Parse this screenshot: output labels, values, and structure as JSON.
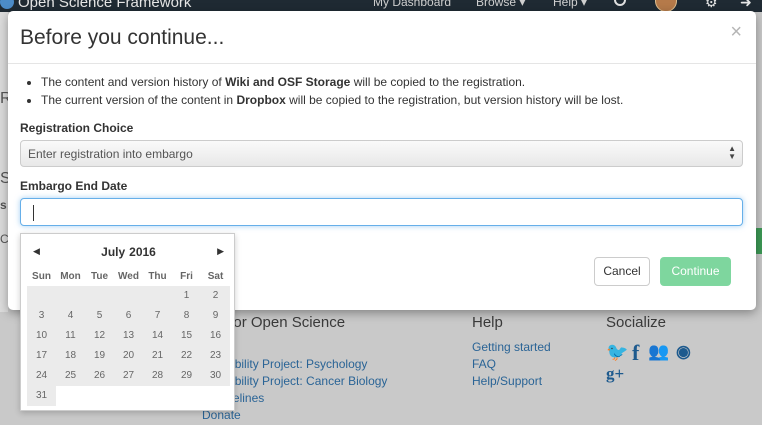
{
  "navbar": {
    "brand": "Open Science Framework",
    "links": [
      "My Dashboard",
      "Browse ▾",
      "Help ▾"
    ]
  },
  "background": {
    "left_chars": [
      "R",
      "S",
      "s",
      "C"
    ]
  },
  "footer": {
    "col1_title": "Center for Open Science",
    "col1_links": [
      "Reproducibility Project: Psychology",
      "Reproducibility Project: Cancer Biology",
      "TOP Guidelines",
      "Donate"
    ],
    "col2_title": "Help",
    "col2_links": [
      "Getting started",
      "FAQ",
      "Help/Support"
    ],
    "col3_title": "Socialize",
    "social_icons": [
      "twitter-icon",
      "facebook-icon",
      "group-icon",
      "github-icon",
      "google-plus-icon"
    ]
  },
  "modal": {
    "title": "Before you continue...",
    "close": "×",
    "bullet1": {
      "pre": "The content and version history of ",
      "bold": "Wiki and OSF Storage",
      "post": " will be copied to the registration."
    },
    "bullet2": {
      "pre": "The current version of the content in ",
      "bold": "Dropbox",
      "post": " will be copied to the registration, but version history will be lost."
    },
    "registration_label": "Registration Choice",
    "registration_value": "Enter registration into embargo",
    "embargo_label": "Embargo End Date",
    "embargo_value": "",
    "cancel_label": "Cancel",
    "continue_label": "Continue"
  },
  "datepicker": {
    "month": "July",
    "year": "2016",
    "weekdays": [
      "Sun",
      "Mon",
      "Tue",
      "Wed",
      "Thu",
      "Fri",
      "Sat"
    ],
    "weeks": [
      [
        "",
        "",
        "",
        "",
        "",
        "1",
        "2"
      ],
      [
        "3",
        "4",
        "5",
        "6",
        "7",
        "8",
        "9"
      ],
      [
        "10",
        "11",
        "12",
        "13",
        "14",
        "15",
        "16"
      ],
      [
        "17",
        "18",
        "19",
        "20",
        "21",
        "22",
        "23"
      ],
      [
        "24",
        "25",
        "26",
        "27",
        "28",
        "29",
        "30"
      ],
      [
        "31",
        null,
        null,
        null,
        null,
        null,
        null
      ]
    ]
  },
  "colors": {
    "continue_button": "#7ed69e",
    "input_focus": "#66afe9",
    "navbar": "#1f2a33"
  }
}
